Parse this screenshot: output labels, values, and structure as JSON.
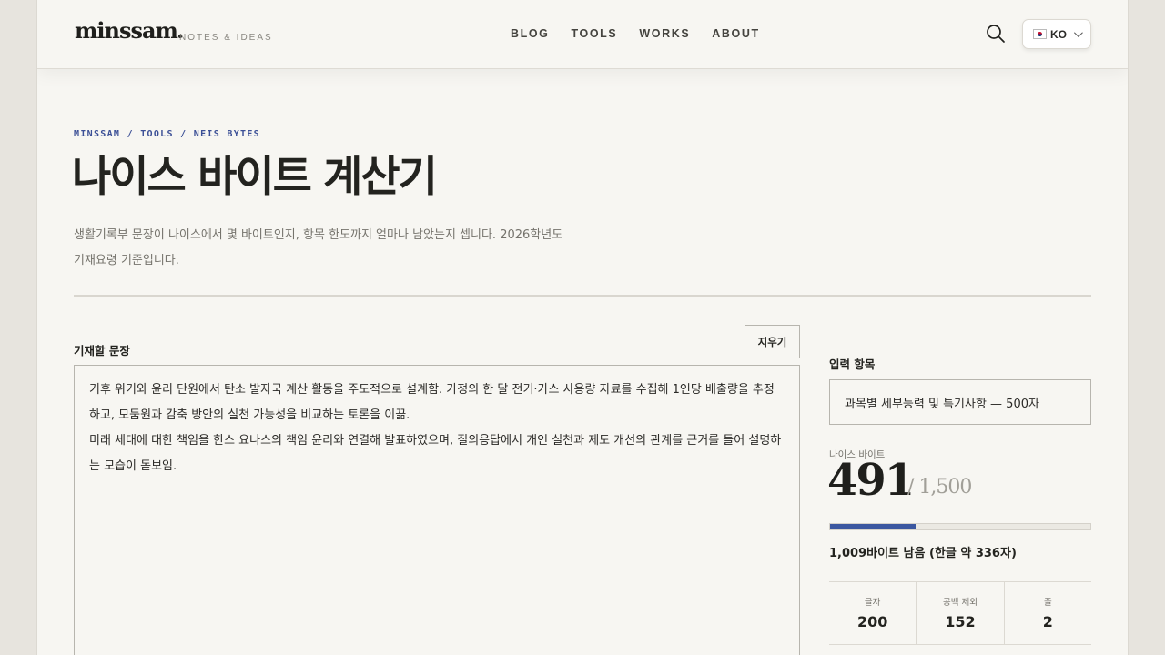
{
  "header": {
    "logo": "minssam",
    "tagline": "NOTES & IDEAS",
    "nav": [
      {
        "label": "BLOG"
      },
      {
        "label": "TOOLS"
      },
      {
        "label": "WORKS"
      },
      {
        "label": "ABOUT"
      }
    ],
    "search_icon": "search-icon",
    "language": {
      "flag": "korea-flag-icon",
      "label": "KO",
      "chevron": "chevron-down-icon"
    }
  },
  "hero": {
    "breadcrumb": "MINSSAM / TOOLS / NEIS BYTES",
    "title": "나이스 바이트 계산기",
    "intro_line1": "생활기록부 문장이 나이스에서 몇 바이트인지, 항목 한도까지 얼마나 남았는지 셉니다. 2026학년도",
    "intro_line2": "기재요령 기준입니다."
  },
  "editor": {
    "label": "기재할 문장",
    "clear_label": "지우기",
    "paragraph1": "기후 위기와 윤리 단원에서 탄소 발자국 계산 활동을 주도적으로 설계함. 가정의 한 달 전기·가스 사용량 자료를 수집해 1인당 배출량을 추정하고, 모둠원과 감축 방안의 실천 가능성을 비교하는 토론을 이끎.",
    "paragraph2": "미래 세대에 대한 책임을 한스 요나스의 책임 윤리와 연결해 발표하였으며, 질의응답에서 개인 실천과 제도 개선의 관계를 근거를 들어 설명하는 모습이 돋보임."
  },
  "panel": {
    "field_label": "입력 항목",
    "field_value": "과목별 세부능력 및 특기사항 — 500자",
    "bytes_label": "나이스 바이트",
    "bytes_value": "491",
    "bytes_limit": "/ 1,500",
    "progress_fraction": 0.327,
    "remaining": "1,009바이트 남음 (한글 약 336자)",
    "stats": [
      {
        "label": "글자",
        "value": "200"
      },
      {
        "label": "공백 제외",
        "value": "152"
      },
      {
        "label": "줄",
        "value": "2"
      }
    ]
  },
  "colors": {
    "accent": "#3b57a0",
    "background": "#f7f6f2",
    "text": "#23231f"
  }
}
